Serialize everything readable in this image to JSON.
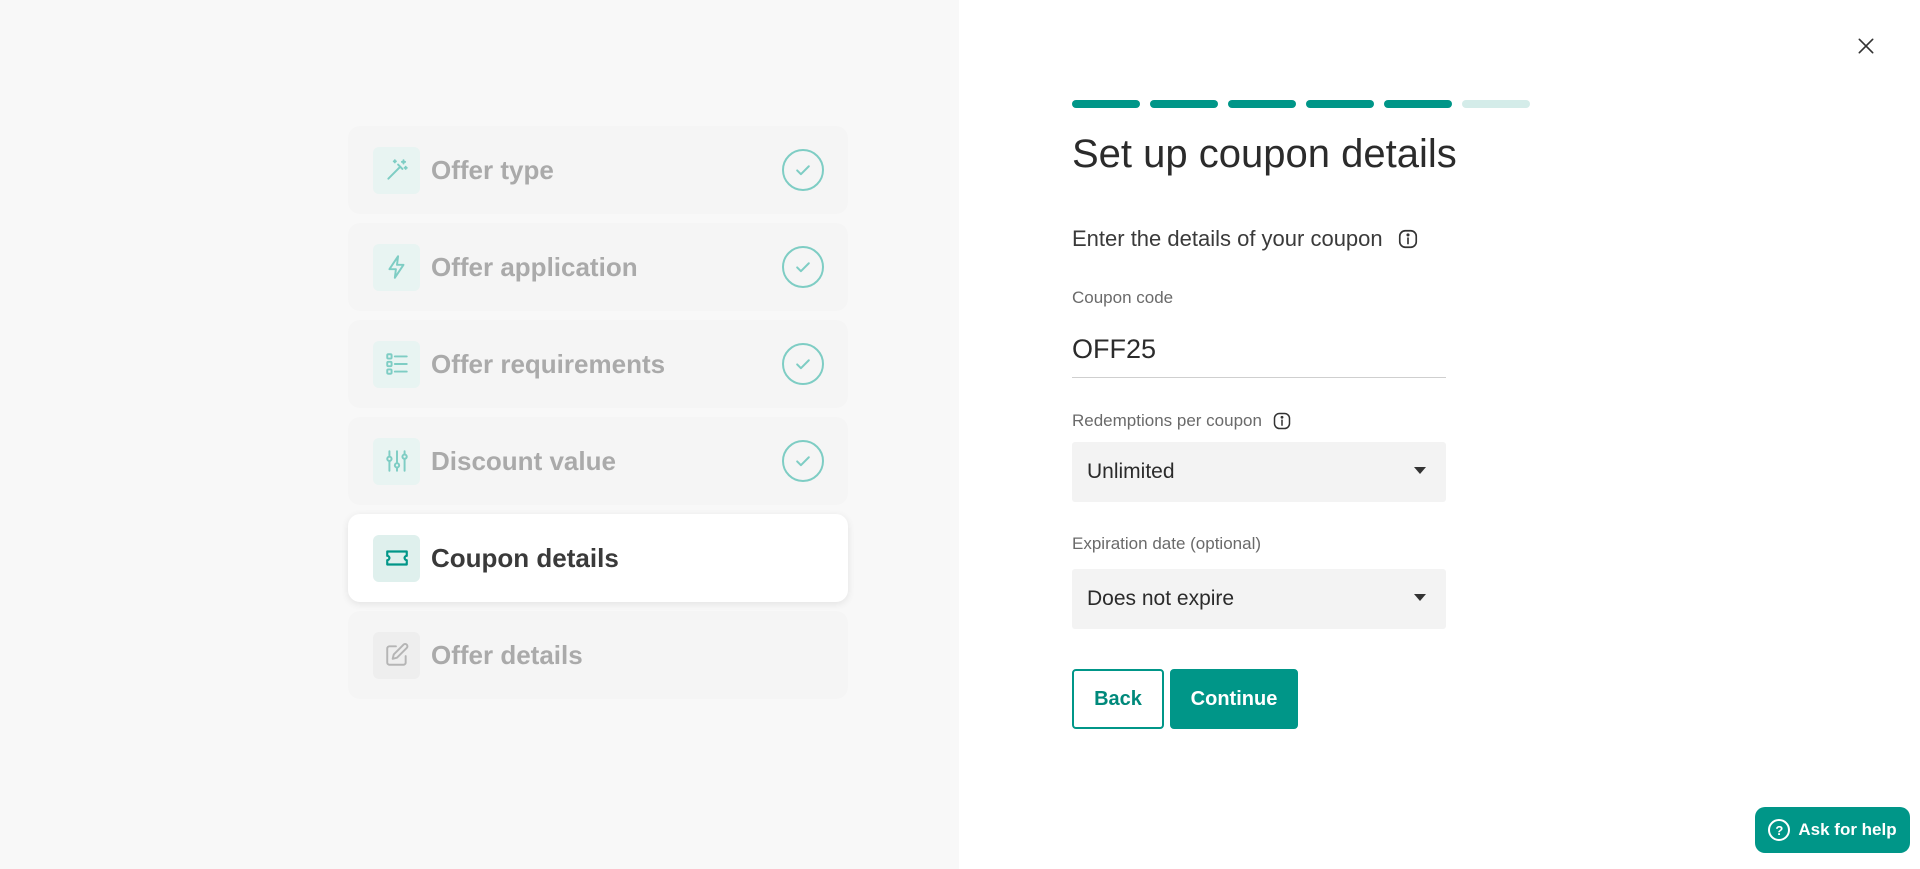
{
  "steps": [
    {
      "label": "Offer type",
      "icon": "magic-wand-icon",
      "state": "done"
    },
    {
      "label": "Offer application",
      "icon": "lightning-icon",
      "state": "done"
    },
    {
      "label": "Offer requirements",
      "icon": "checklist-icon",
      "state": "done"
    },
    {
      "label": "Discount value",
      "icon": "sliders-icon",
      "state": "done"
    },
    {
      "label": "Coupon details",
      "icon": "ticket-icon",
      "state": "active"
    },
    {
      "label": "Offer details",
      "icon": "edit-icon",
      "state": "todo"
    }
  ],
  "progress": {
    "completed": 5,
    "total": 6
  },
  "form": {
    "title": "Set up coupon details",
    "subtitle": "Enter the details of your coupon",
    "coupon_code_label": "Coupon code",
    "coupon_code_value": "OFF25",
    "redemptions_label": "Redemptions per coupon",
    "redemptions_value": "Unlimited",
    "expiration_label": "Expiration date (optional)",
    "expiration_value": "Does not expire"
  },
  "buttons": {
    "back": "Back",
    "continue": "Continue",
    "help": "Ask for help"
  },
  "colors": {
    "accent": "#009688",
    "accent_light": "#7ecdc4",
    "progress_todo": "#d4ece9"
  }
}
